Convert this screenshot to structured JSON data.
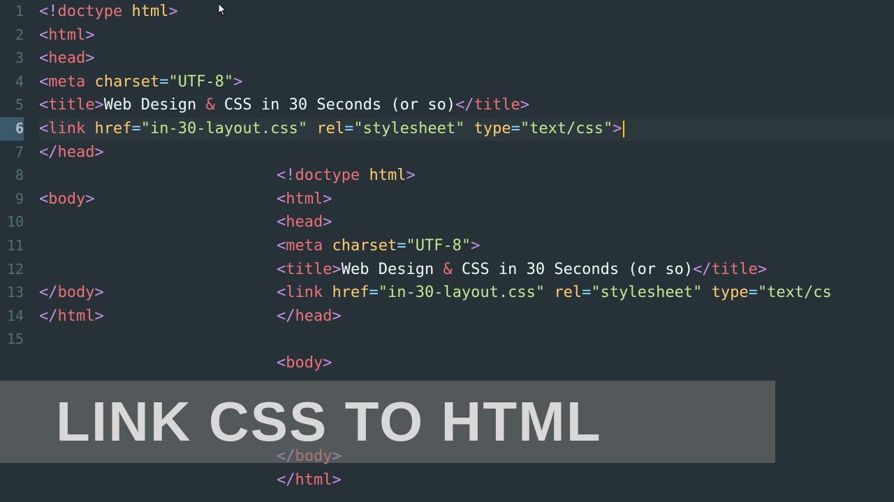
{
  "gutter": [
    "1",
    "2",
    "3",
    "4",
    "5",
    "6",
    "7",
    "8",
    "9",
    "10",
    "11",
    "12",
    "13",
    "14",
    "15"
  ],
  "activeLine": 6,
  "code": {
    "doctype": {
      "open": "<!",
      "name": "doctype",
      "space": " ",
      "attr": "html",
      "close": ">"
    },
    "html_open": {
      "open": "<",
      "name": "html",
      "close": ">"
    },
    "head_open": {
      "open": "<",
      "name": "head",
      "close": ">"
    },
    "meta": {
      "open": "<",
      "name": "meta",
      "sp": " ",
      "a1": "charset",
      "eq": "=",
      "v1": "\"UTF-8\"",
      "close": ">"
    },
    "title": {
      "open": "<",
      "name": "title",
      "close": ">",
      "text": "Web Design ",
      "amp": "&",
      "text2": " CSS in 30 Seconds (or so)",
      "copen": "</",
      "cname": "title",
      "cclose": ">"
    },
    "link": {
      "open": "<",
      "name": "link",
      "sp": " ",
      "a1": "href",
      "eq": "=",
      "v1": "\"in-30-layout.css\"",
      "sp2": " ",
      "a2": "rel",
      "v2": "\"stylesheet\"",
      "sp3": " ",
      "a3": "type",
      "v3": "\"text/css\"",
      "close": ">"
    },
    "head_close": {
      "open": "</",
      "name": "head",
      "close": ">"
    },
    "body_open": {
      "open": "<",
      "name": "body",
      "close": ">"
    },
    "body_close": {
      "open": "</",
      "name": "body",
      "close": ">"
    },
    "html_close": {
      "open": "</",
      "name": "html",
      "close": ">"
    },
    "link_trunc": {
      "v3": "\"text/cs"
    }
  },
  "banner": "LINK CSS TO HTML"
}
